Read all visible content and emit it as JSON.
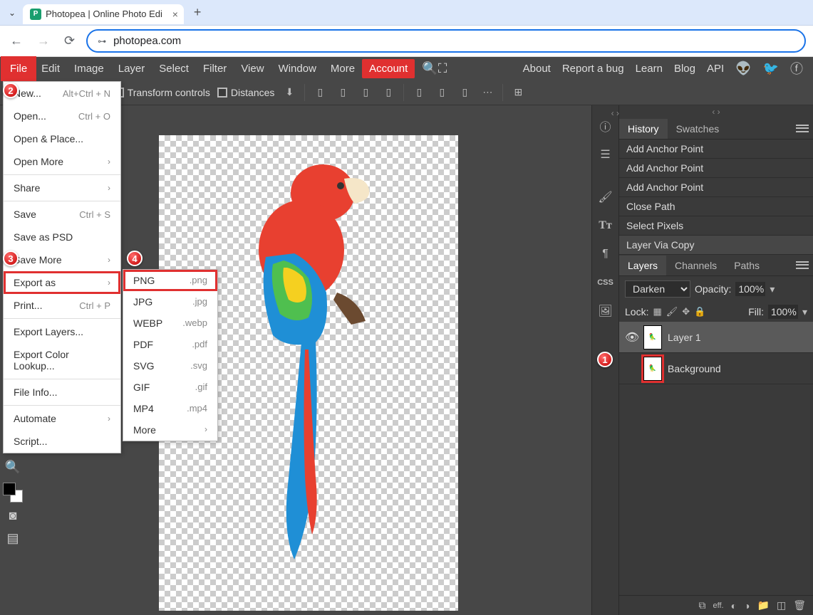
{
  "browser": {
    "tab_title": "Photopea | Online Photo Edi",
    "url": "photopea.com"
  },
  "menubar": {
    "items": [
      "File",
      "Edit",
      "Image",
      "Layer",
      "Select",
      "Filter",
      "View",
      "Window",
      "More"
    ],
    "account": "Account",
    "right_links": [
      "About",
      "Report a bug",
      "Learn",
      "Blog",
      "API"
    ]
  },
  "options_bar": {
    "transform_controls": "Transform controls",
    "distances": "Distances"
  },
  "file_menu": [
    {
      "label": "New...",
      "shortcut": "Alt+Ctrl + N"
    },
    {
      "label": "Open...",
      "shortcut": "Ctrl + O"
    },
    {
      "label": "Open & Place..."
    },
    {
      "label": "Open More",
      "submenu": true
    },
    {
      "sep": true
    },
    {
      "label": "Share",
      "submenu": true
    },
    {
      "sep": true
    },
    {
      "label": "Save",
      "shortcut": "Ctrl + S"
    },
    {
      "label": "Save as PSD"
    },
    {
      "label": "Save More",
      "submenu": true
    },
    {
      "label": "Export as",
      "submenu": true,
      "highlight": true
    },
    {
      "label": "Print...",
      "shortcut": "Ctrl + P"
    },
    {
      "sep": true
    },
    {
      "label": "Export Layers..."
    },
    {
      "label": "Export Color Lookup..."
    },
    {
      "sep": true
    },
    {
      "label": "File Info..."
    },
    {
      "sep": true
    },
    {
      "label": "Automate",
      "submenu": true
    },
    {
      "label": "Script..."
    }
  ],
  "export_menu": [
    {
      "label": "PNG",
      "ext": ".png",
      "highlight": true
    },
    {
      "label": "JPG",
      "ext": ".jpg"
    },
    {
      "label": "WEBP",
      "ext": ".webp"
    },
    {
      "label": "PDF",
      "ext": ".pdf"
    },
    {
      "label": "SVG",
      "ext": ".svg"
    },
    {
      "label": "GIF",
      "ext": ".gif"
    },
    {
      "label": "MP4",
      "ext": ".mp4"
    },
    {
      "label": "More",
      "submenu": true
    }
  ],
  "history_panel": {
    "tabs": [
      "History",
      "Swatches"
    ],
    "items": [
      "Add Anchor Point",
      "Add Anchor Point",
      "Add Anchor Point",
      "Close Path",
      "Select Pixels",
      "Layer Via Copy"
    ]
  },
  "layers_panel": {
    "tabs": [
      "Layers",
      "Channels",
      "Paths"
    ],
    "blend_mode": "Darken",
    "opacity_label": "Opacity:",
    "opacity_value": "100%",
    "lock_label": "Lock:",
    "fill_label": "Fill:",
    "fill_value": "100%",
    "layers": [
      {
        "name": "Layer 1",
        "visible": true,
        "active": true,
        "highlight": false
      },
      {
        "name": "Background",
        "visible": false,
        "active": false,
        "highlight": true
      }
    ]
  },
  "annotations": [
    "1",
    "2",
    "3",
    "4"
  ]
}
